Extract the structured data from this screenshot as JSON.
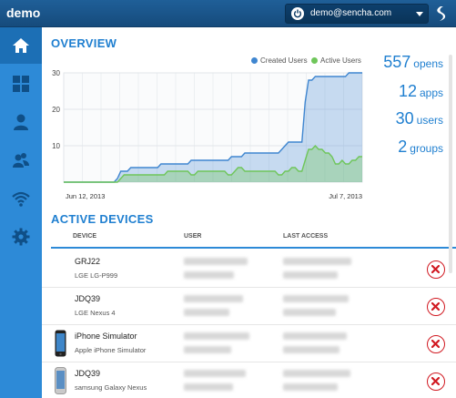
{
  "app": {
    "title": "demo"
  },
  "user": {
    "email": "demo@sencha.com"
  },
  "overview": {
    "title": "OVERVIEW"
  },
  "stats": [
    {
      "value": "557",
      "label": "opens"
    },
    {
      "value": "12",
      "label": "apps"
    },
    {
      "value": "30",
      "label": "users"
    },
    {
      "value": "2",
      "label": "groups"
    }
  ],
  "chart_data": {
    "type": "area",
    "x_tick_labels": [
      "Jun 12, 2013",
      "Jul 7, 2013"
    ],
    "ylim": [
      0,
      30
    ],
    "y_ticks": [
      10,
      20,
      30
    ],
    "grid": true,
    "legend_position": "top-right",
    "series": [
      {
        "name": "Created Users",
        "color": "#3f86d0",
        "values": [
          0,
          0,
          0,
          0,
          0,
          0,
          0,
          0,
          0,
          0,
          0,
          0,
          0,
          0,
          0,
          0,
          1,
          3,
          3,
          3,
          4,
          4,
          4,
          4,
          4,
          4,
          4,
          4,
          4,
          5,
          5,
          5,
          5,
          5,
          5,
          5,
          5,
          5,
          6,
          6,
          6,
          6,
          6,
          6,
          6,
          6,
          6,
          6,
          6,
          6,
          7,
          7,
          7,
          7,
          8,
          8,
          8,
          8,
          8,
          8,
          8,
          8,
          8,
          8,
          8,
          9,
          10,
          11,
          11,
          11,
          11,
          11,
          22,
          28,
          28,
          29,
          29,
          29,
          29,
          29,
          29,
          29,
          29,
          29,
          29,
          30,
          30,
          30,
          30,
          30
        ]
      },
      {
        "name": "Active Users",
        "color": "#6fc65a",
        "values": [
          0,
          0,
          0,
          0,
          0,
          0,
          0,
          0,
          0,
          0,
          0,
          0,
          0,
          0,
          0,
          0,
          0,
          1,
          2,
          2,
          2,
          2,
          2,
          2,
          2,
          2,
          2,
          2,
          2,
          2,
          2,
          3,
          3,
          3,
          3,
          3,
          3,
          3,
          2,
          2,
          3,
          3,
          3,
          3,
          3,
          3,
          3,
          3,
          3,
          2,
          2,
          3,
          4,
          4,
          3,
          3,
          3,
          3,
          3,
          3,
          3,
          3,
          3,
          3,
          2,
          2,
          3,
          3,
          4,
          4,
          3,
          3,
          6,
          9,
          9,
          10,
          9,
          9,
          8,
          8,
          7,
          5,
          5,
          6,
          5,
          5,
          6,
          6,
          7,
          7
        ]
      }
    ]
  },
  "devices": {
    "title": "ACTIVE DEVICES",
    "columns": [
      "DEVICE",
      "USER",
      "LAST ACCESS"
    ],
    "rows": [
      {
        "name": "GRJ22",
        "model": "LGE LG-P999",
        "icon": "none"
      },
      {
        "name": "JDQ39",
        "model": "LGE Nexus 4",
        "icon": "none"
      },
      {
        "name": "iPhone Simulator",
        "model": "Apple iPhone Simulator",
        "icon": "iphone-icon"
      },
      {
        "name": "JDQ39",
        "model": "samsung Galaxy Nexus",
        "icon": "galaxy-nexus-icon"
      }
    ]
  },
  "colors": {
    "accent": "#1f7fd0",
    "sidebar": "#2d8ad7",
    "delete": "#d11a22"
  }
}
